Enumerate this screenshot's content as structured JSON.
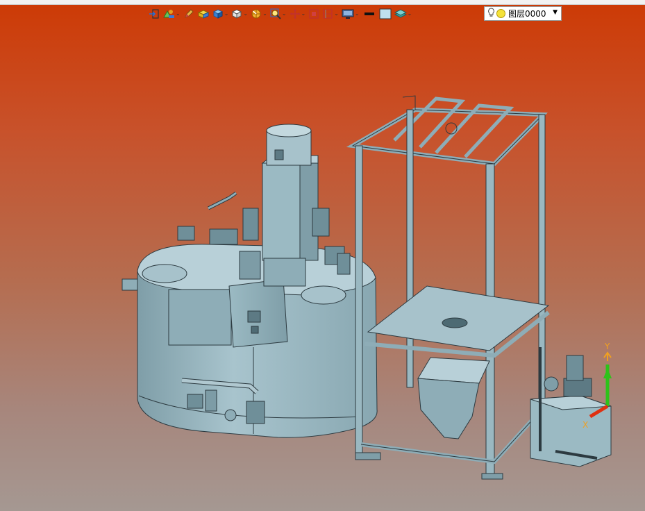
{
  "window": {
    "background_top": "#cd3a05",
    "background_bottom": "#a59892"
  },
  "toolbar": {
    "items": [
      {
        "icon": "exit-sketch-icon",
        "dropdown": false
      },
      {
        "icon": "sketch-plane-icon",
        "dropdown": true
      },
      {
        "icon": "pencil-icon",
        "dropdown": false
      },
      {
        "icon": "block-icon",
        "dropdown": false
      },
      {
        "icon": "solid-box-icon",
        "dropdown": true
      },
      {
        "icon": "view-cube-icon",
        "dropdown": true
      },
      {
        "icon": "render-style-icon",
        "dropdown": true
      },
      {
        "icon": "zoom-icon",
        "dropdown": true
      },
      {
        "icon": "pan-icon",
        "dropdown": true
      },
      {
        "icon": "fit-view-icon",
        "dropdown": false
      },
      {
        "icon": "section-view-icon",
        "dropdown": true
      },
      {
        "icon": "display-icon",
        "dropdown": true
      },
      {
        "icon": "line-color-icon",
        "dropdown": false
      },
      {
        "icon": "fill-color-icon",
        "dropdown": false
      },
      {
        "icon": "layer-manager-icon",
        "dropdown": true
      }
    ],
    "layer_select": {
      "value": "图层0000",
      "dropdown_symbol": "▼"
    }
  },
  "triad": {
    "y_label": "Y",
    "x_label": "X"
  },
  "colors": {
    "model_fill": "#9fbfc9",
    "model_dark": "#6f8f99",
    "model_line": "#2c3a40",
    "axis_y": "#2ec21a",
    "axis_x": "#e03010",
    "axis_z": "#f0a020"
  }
}
